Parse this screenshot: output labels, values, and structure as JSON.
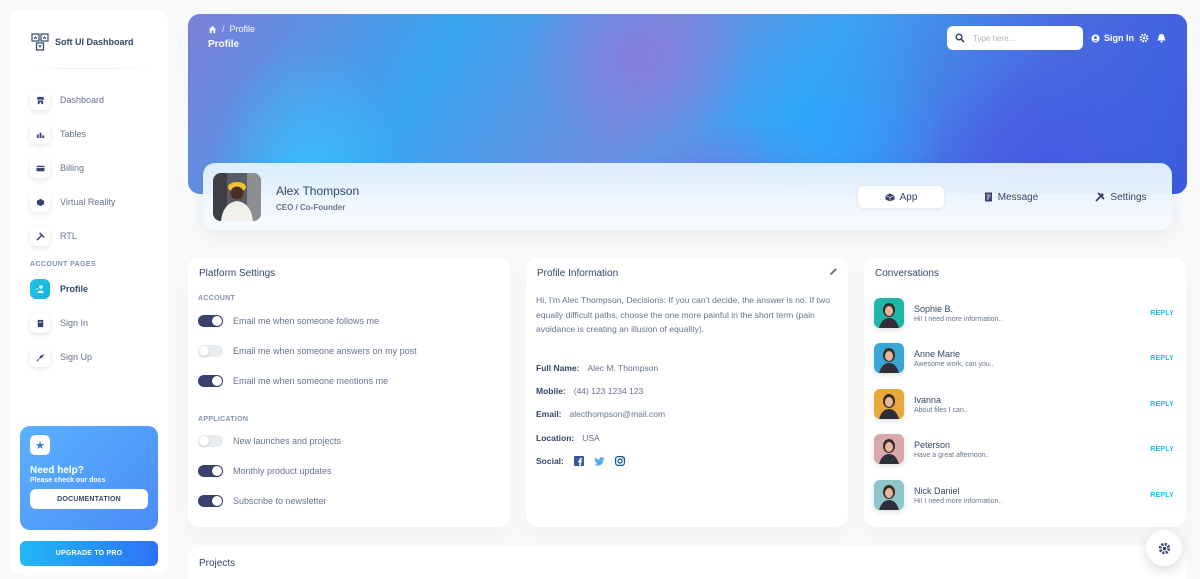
{
  "brand": {
    "name": "Soft UI Dashboard"
  },
  "sidebar": {
    "items": [
      {
        "label": "Dashboard",
        "icon": "shop-icon",
        "active": false
      },
      {
        "label": "Tables",
        "icon": "chart-icon",
        "active": false
      },
      {
        "label": "Billing",
        "icon": "credit-card-icon",
        "active": false
      },
      {
        "label": "Virtual Reality",
        "icon": "cube-icon",
        "active": false
      },
      {
        "label": "RTL",
        "icon": "wrench-icon",
        "active": false
      }
    ],
    "section_label": "ACCOUNT PAGES",
    "account_items": [
      {
        "label": "Profile",
        "icon": "user-icon",
        "active": true
      },
      {
        "label": "Sign In",
        "icon": "document-icon",
        "active": false
      },
      {
        "label": "Sign Up",
        "icon": "rocket-icon",
        "active": false
      }
    ],
    "help": {
      "title": "Need help?",
      "subtitle": "Please check our docs",
      "button": "DOCUMENTATION",
      "icon": "star-icon"
    },
    "upgrade_button": "UPGRADE TO PRO"
  },
  "header": {
    "breadcrumb": [
      "Profile"
    ],
    "title": "Profile",
    "search_placeholder": "Type here...",
    "search_value": "",
    "signin_label": "Sign In"
  },
  "profile": {
    "name": "Alex Thompson",
    "role": "CEO / Co-Founder",
    "tabs": [
      {
        "label": "App",
        "icon": "cube-icon",
        "active": true
      },
      {
        "label": "Message",
        "icon": "document-icon",
        "active": false
      },
      {
        "label": "Settings",
        "icon": "tools-icon",
        "active": false
      }
    ]
  },
  "platform_settings": {
    "title": "Platform Settings",
    "account_label": "ACCOUNT",
    "account": [
      {
        "label": "Email me when someone follows me",
        "on": true
      },
      {
        "label": "Email me when someone answers on my post",
        "on": false
      },
      {
        "label": "Email me when someone mentions me",
        "on": true
      }
    ],
    "application_label": "APPLICATION",
    "application": [
      {
        "label": "New launches and projects",
        "on": false
      },
      {
        "label": "Monthly product updates",
        "on": true
      },
      {
        "label": "Subscribe to newsletter",
        "on": true
      }
    ]
  },
  "profile_information": {
    "title": "Profile Information",
    "bio": "Hi, I'm Alec Thompson, Decisions: If you can't decide, the answer is no. If two equally difficult paths, choose the one more painful in the short term (pain avoidance is creating an illusion of equality).",
    "fields": [
      {
        "key": "Full Name:",
        "value": "Alec M. Thompson"
      },
      {
        "key": "Mobile:",
        "value": "(44) 123 1234 123"
      },
      {
        "key": "Email:",
        "value": "alecthompson@mail.com"
      },
      {
        "key": "Location:",
        "value": "USA"
      }
    ],
    "social_label": "Social:",
    "social": [
      "facebook-icon",
      "twitter-icon",
      "instagram-icon"
    ],
    "colors": {
      "facebook": "#3b5998",
      "twitter": "#55acee",
      "instagram": "#125688"
    }
  },
  "conversations": {
    "title": "Conversations",
    "reply_label": "REPLY",
    "items": [
      {
        "name": "Sophie B.",
        "message": "Hi! I need more information..",
        "color": "#1fb5a8"
      },
      {
        "name": "Anne Marie",
        "message": "Awesome work, can you..",
        "color": "#3aa6d8"
      },
      {
        "name": "Ivanna",
        "message": "About files I can..",
        "color": "#e8a93a"
      },
      {
        "name": "Peterson",
        "message": "Have a great afternoon..",
        "color": "#d9a9a9"
      },
      {
        "name": "Nick Daniel",
        "message": "Hi! I need more information..",
        "color": "#8fc6c9"
      }
    ]
  },
  "projects": {
    "title": "Projects"
  },
  "colors": {
    "accent": "#17c1e8",
    "dark": "#3a416f",
    "heading": "#344767",
    "text": "#67748e"
  }
}
